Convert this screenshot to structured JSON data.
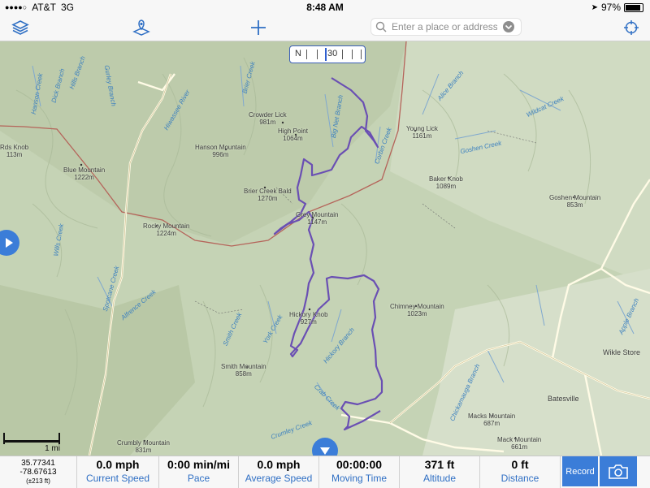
{
  "status": {
    "carrier": "AT&T",
    "network": "3G",
    "time": "8:48 AM",
    "battery": "97%",
    "battery_level": 0.97
  },
  "nav": {
    "search_placeholder": "Enter a place or address"
  },
  "compass": {
    "dir": "N",
    "heading": "30"
  },
  "places": [
    {
      "name": "Crowder Lick",
      "elev": "981m"
    },
    {
      "name": "High Point",
      "elev": "1064m"
    },
    {
      "name": "Young Lick",
      "elev": "1161m"
    },
    {
      "name": "Hanson Mountain",
      "elev": "996m"
    },
    {
      "name": "Blue Mountain",
      "elev": "1222m"
    },
    {
      "name": "Baker Knob",
      "elev": "1089m"
    },
    {
      "name": "Brier Creek Bald",
      "elev": "1270m"
    },
    {
      "name": "Goshen Mountain",
      "elev": "853m"
    },
    {
      "name": "Rocky Mountain",
      "elev": "1224m"
    },
    {
      "name": "Grey Mountain",
      "elev": "1147m"
    },
    {
      "name": "Chimney Mountain",
      "elev": "1023m"
    },
    {
      "name": "Hickory Knob",
      "elev": "927m"
    },
    {
      "name": "Smith Mountain",
      "elev": "858m"
    },
    {
      "name": "Macks Mountain",
      "elev": "687m"
    },
    {
      "name": "Mack Mountain",
      "elev": "661m"
    },
    {
      "name": "Crumbly Mountain",
      "elev": "831m"
    },
    {
      "name": "Rds Knob",
      "elev": "113m"
    }
  ],
  "towns": {
    "wikle": "Wikle Store",
    "batesville": "Batesville"
  },
  "streams": [
    "Brier Creek",
    "Big Net Branch",
    "Corbin Creek",
    "Alice Branch",
    "Wildcat Creek",
    "Goshen Creek",
    "Hiwassee River",
    "Hickory Branch",
    "Crab Creek",
    "Crumley Creek",
    "Smith Creek",
    "York Creek",
    "Spotcane Creek",
    "Chickamauga Branch",
    "Apple Branch",
    "Wills Creek",
    "Dick Branch",
    "Hanson Creek",
    "Gurley Branch",
    "Hills Branch",
    "Alfrence Creek"
  ],
  "scale": "1 mi",
  "stats": {
    "lat": "35.77341",
    "lon": "-78.67613",
    "accuracy": "(±213 ft)",
    "items": [
      {
        "value": "0.0 mph",
        "label": "Current Speed"
      },
      {
        "value": "0:00 min/mi",
        "label": "Pace"
      },
      {
        "value": "0.0 mph",
        "label": "Average Speed"
      },
      {
        "value": "00:00:00",
        "label": "Moving Time"
      },
      {
        "value": "371 ft",
        "label": "Altitude"
      },
      {
        "value": "0 ft",
        "label": "Distance"
      }
    ],
    "record_label": "Record"
  },
  "colors": {
    "accent": "#3b7dd8",
    "route": "#6a4fb3",
    "boundary": "#b5645a",
    "road": "#fffbe6"
  }
}
